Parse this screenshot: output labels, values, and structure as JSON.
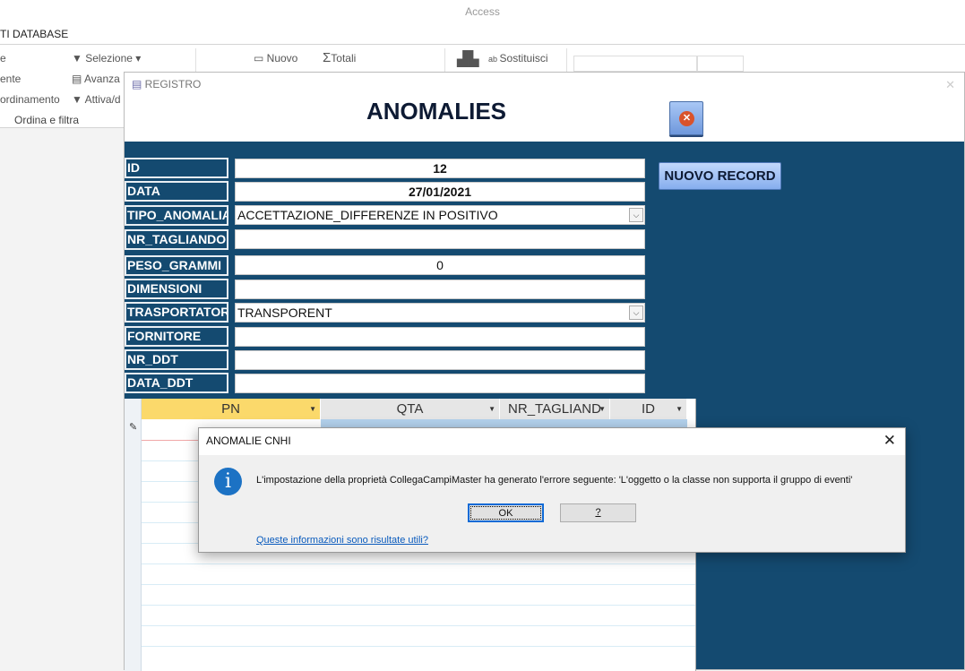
{
  "app": {
    "title": "Access",
    "tab": "TI DATABASE"
  },
  "ribbon": {
    "items_left": [
      "e",
      "ente",
      "ordinamento"
    ],
    "filter": [
      "Selezione",
      "Avanza",
      "Attiva/d"
    ],
    "group_label": "Ordina e filtra",
    "nuovo": "Nuovo",
    "totali": "Totali",
    "sostituisci": "Sostituisci"
  },
  "form": {
    "window_title": "REGISTRO",
    "title": "ANOMALIES",
    "close_icon": "close-icon",
    "new_record": "NUOVO RECORD",
    "fields": [
      {
        "label": "ID",
        "value": "12"
      },
      {
        "label": "DATA",
        "value": "27/01/2021"
      },
      {
        "label": "TIPO_ANOMALIA",
        "value": "ACCETTAZIONE_DIFFERENZE IN POSITIVO"
      },
      {
        "label": "NR_TAGLIANDO",
        "value": ""
      },
      {
        "label": "PESO_GRAMMI",
        "value": "0"
      },
      {
        "label": "DIMENSIONI",
        "value": ""
      },
      {
        "label": "TRASPORTATORE",
        "value": "TRANSPORENT"
      },
      {
        "label": "FORNITORE",
        "value": ""
      },
      {
        "label": "NR_DDT",
        "value": ""
      },
      {
        "label": "DATA_DDT",
        "value": ""
      }
    ],
    "subform_columns": [
      "PN",
      "QTA",
      "NR_TAGLIAND",
      "ID"
    ]
  },
  "dialog": {
    "title": "ANOMALIE CNHI",
    "message": "L'impostazione della proprietà CollegaCampiMaster ha generato l'errore seguente: 'L'oggetto o la classe non supporta il gruppo di eventi'",
    "ok": "OK",
    "help": "?",
    "link": "Queste informazioni sono risultate utili?"
  }
}
